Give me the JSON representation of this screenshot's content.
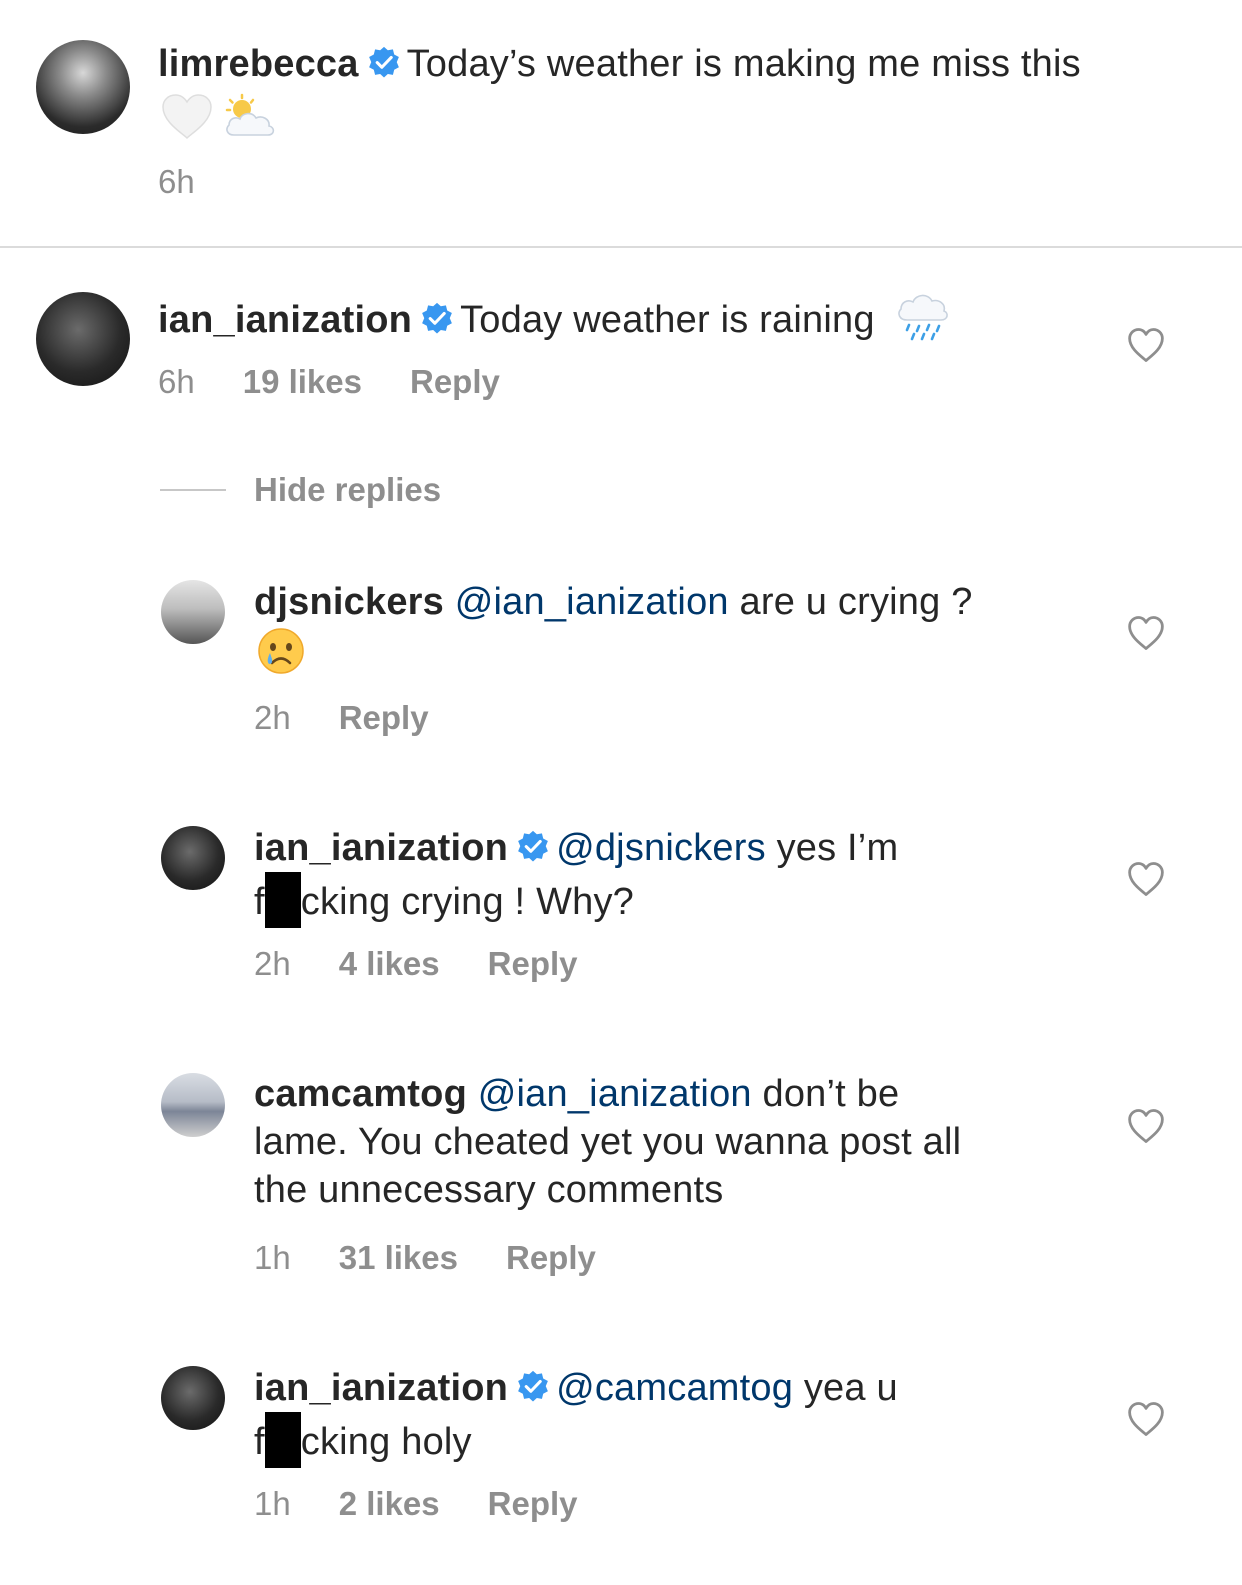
{
  "caption": {
    "username": "limrebecca",
    "text": "Today’s weather is making me miss this",
    "time": "6h",
    "emoji": [
      "white-heart",
      "sun-behind-cloud"
    ]
  },
  "hide_replies": "Hide replies",
  "comments": [
    {
      "username": "ian_ianization",
      "text": "Today weather is raining",
      "emoji": "cloud-with-rain",
      "time": "6h",
      "likes": "19 likes",
      "reply": "Reply"
    },
    {
      "username": "djsnickers",
      "mention": "@ian_ianization",
      "text": "are u crying ?",
      "emoji": "crying-face",
      "time": "2h",
      "reply": "Reply"
    },
    {
      "username": "ian_ianization",
      "mention": "@djsnickers",
      "text_a": "yes I’m",
      "text_b_pre": "f",
      "text_b_post": "cking crying ! Why?",
      "time": "2h",
      "likes": "4 likes",
      "reply": "Reply"
    },
    {
      "username": "camcamtog",
      "mention": "@ian_ianization",
      "line1": "don’t be",
      "line2": "lame. You cheated yet you wanna post all",
      "line3": "the unnecessary comments",
      "time": "1h",
      "likes": "31 likes",
      "reply": "Reply"
    },
    {
      "username": "ian_ianization",
      "mention": "@camcamtog",
      "text_a": "yea u",
      "text_b_pre": "f",
      "text_b_post": "cking holy",
      "time": "1h",
      "likes": "2 likes",
      "reply": "Reply"
    }
  ],
  "colors": {
    "text": "#262626",
    "mention": "#00376b",
    "meta": "#8e8e8e",
    "verified": "#3897f0"
  }
}
